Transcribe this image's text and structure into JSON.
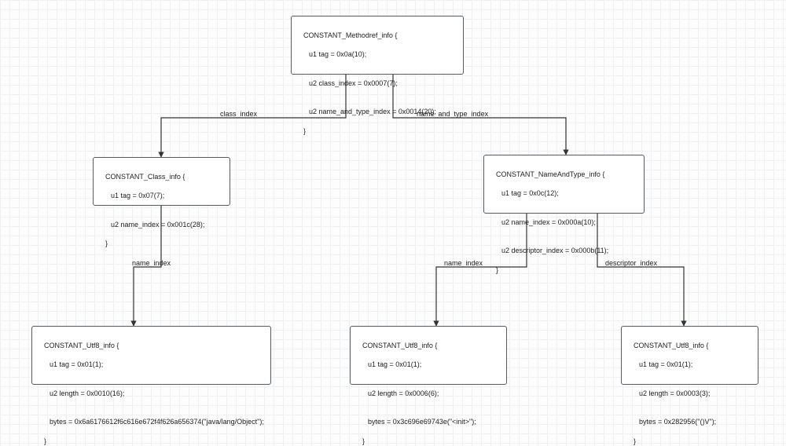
{
  "nodes": {
    "methodref": {
      "title": "CONSTANT_Methodref_info {",
      "line1": "u1 tag = 0x0a(10);",
      "line2": "u2 class_index = 0x0007(7);",
      "line3": "u2 name_and_type_index = 0x0014(20);",
      "close": "}"
    },
    "classinfo": {
      "title": "CONSTANT_Class_info {",
      "line1": "u1 tag = 0x07(7);",
      "line2": "u2 name_index = 0x001c(28);",
      "close": "}"
    },
    "nameandtype": {
      "title": "CONSTANT_NameAndType_info {",
      "line1": "u1 tag = 0x0c(12);",
      "line2": "u2 name_index = 0x000a(10);",
      "line3": "u2 descriptor_index = 0x000b(11);",
      "close": "}"
    },
    "utf8_object": {
      "title": "CONSTANT_Utf8_info {",
      "line1": "u1 tag = 0x01(1);",
      "line2": "u2 length = 0x0010(16);",
      "line3": "bytes = 0x6a6176612f6c616e672f4f626a656374(\"java/lang/Object\");",
      "close": "}"
    },
    "utf8_init": {
      "title": "CONSTANT_Utf8_info {",
      "line1": "u1 tag = 0x01(1);",
      "line2": "u2 length = 0x0006(6);",
      "line3": "bytes = 0x3c696e69743e(\"<init>\");",
      "close": "}"
    },
    "utf8_void": {
      "title": "CONSTANT_Utf8_info {",
      "line1": "u1 tag = 0x01(1);",
      "line2": "u2 length = 0x0003(3);",
      "line3": "bytes = 0x282956(\"()V\");",
      "close": "}"
    }
  },
  "edges": {
    "class_index": "class_index",
    "name_and_type_index": "name_and_type_index",
    "name_index_left": "name_index",
    "name_index_mid": "name_index",
    "descriptor_index": "descriptor_index"
  }
}
